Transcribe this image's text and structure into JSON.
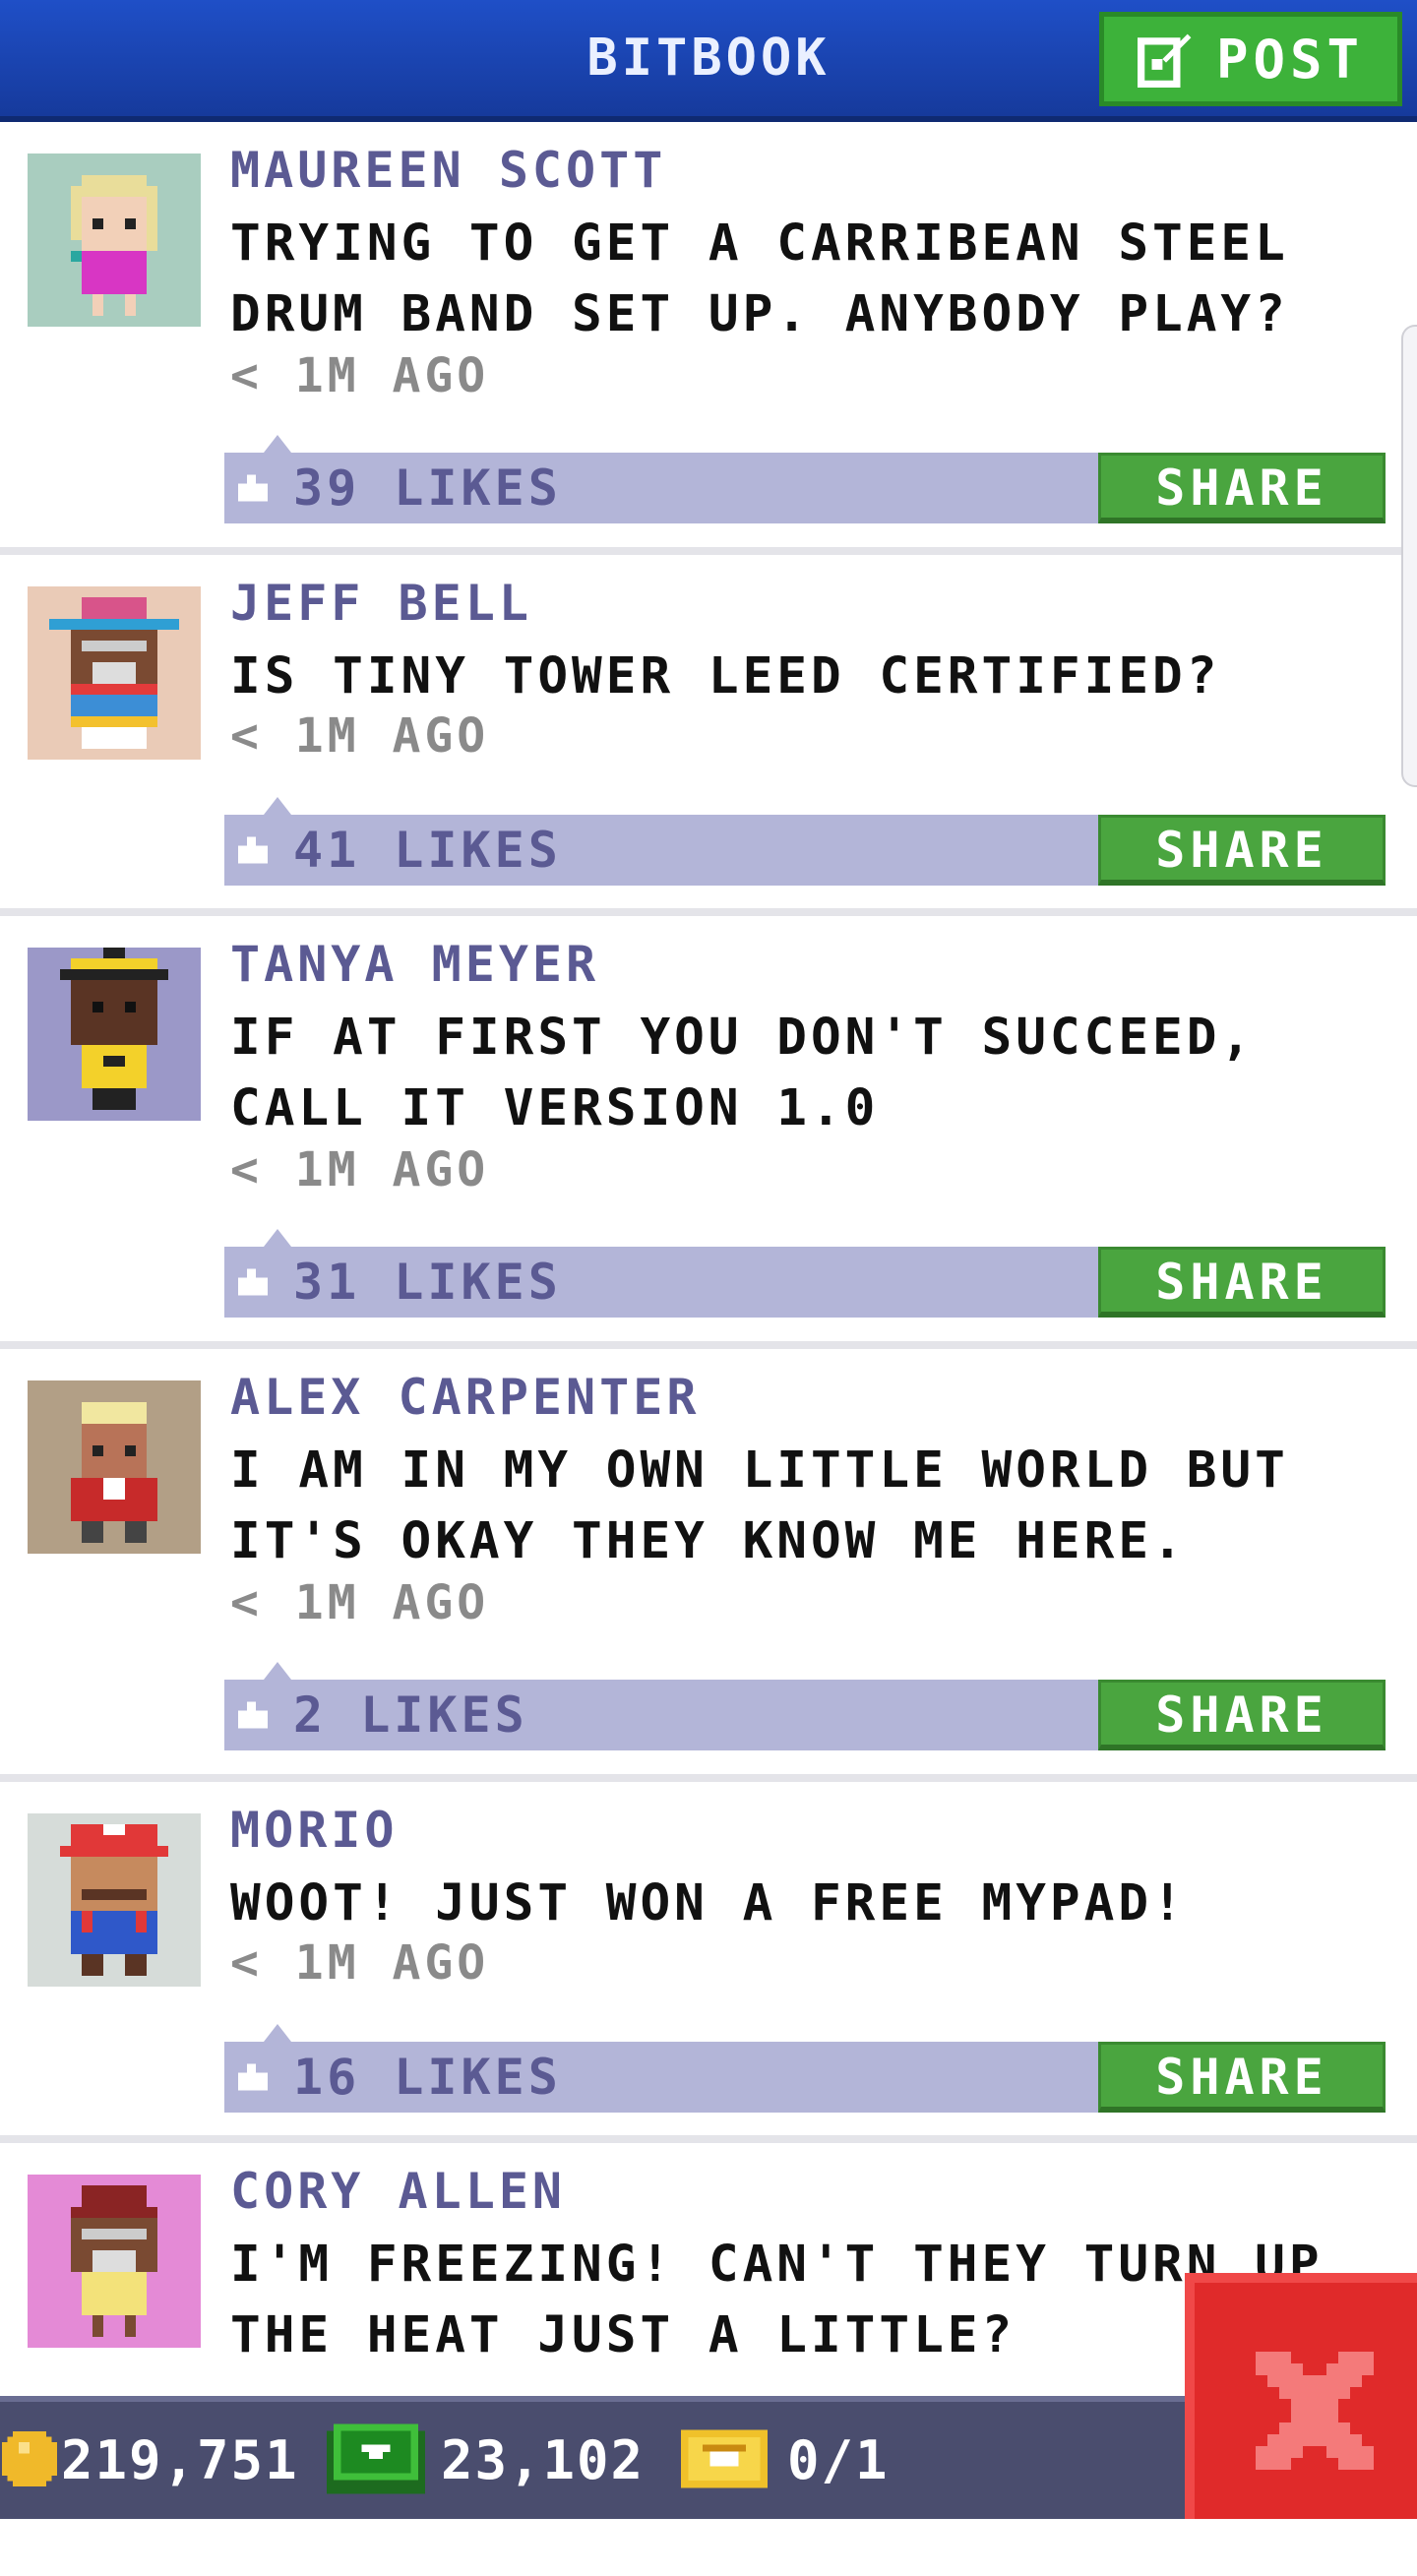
{
  "header": {
    "title": "BITBOOK",
    "post_label": "POST"
  },
  "posts": [
    {
      "author": "MAUREEN SCOTT",
      "message": "TRYING TO GET A CARRIBEAN STEEL DRUM BAND SET UP. ANYBODY PLAY?",
      "timestamp": "< 1M AGO",
      "likes": "39 LIKES",
      "share_label": "SHARE"
    },
    {
      "author": "JEFF BELL",
      "message": "IS TINY TOWER LEED CERTIFIED?",
      "timestamp": "< 1M AGO",
      "likes": "41 LIKES",
      "share_label": "SHARE"
    },
    {
      "author": "TANYA MEYER",
      "message": "IF AT FIRST YOU DON'T SUCCEED, CALL IT VERSION 1.0",
      "timestamp": "< 1M AGO",
      "likes": "31 LIKES",
      "share_label": "SHARE"
    },
    {
      "author": "ALEX CARPENTER",
      "message": "I AM IN MY OWN LITTLE WORLD BUT IT'S OKAY THEY KNOW ME HERE.",
      "timestamp": "< 1M AGO",
      "likes": "2 LIKES",
      "share_label": "SHARE"
    },
    {
      "author": "MORIO",
      "message": "WOOT! JUST WON A FREE MYPAD!",
      "timestamp": "< 1M AGO",
      "likes": "16 LIKES",
      "share_label": "SHARE"
    },
    {
      "author": "CORY ALLEN",
      "message": "I'M FREEZING! CAN'T THEY TURN UP THE HEAT JUST A LITTLE?",
      "timestamp": "",
      "likes": "",
      "share_label": ""
    }
  ],
  "status": {
    "coins": "219,751",
    "bux": "23,102",
    "tickets": "0/1"
  },
  "colors": {
    "header_blue": "#1f4fc7",
    "accent_green": "#4aa53f",
    "likes_bar": "#b3b5d8",
    "author_purple": "#5b5a93",
    "close_red": "#e02a2a"
  },
  "icons": {
    "post": "edit-icon",
    "like": "thumbs-up-icon",
    "coin": "coin-icon",
    "bux": "bux-icon",
    "ticket": "ticket-icon",
    "close": "close-icon"
  }
}
